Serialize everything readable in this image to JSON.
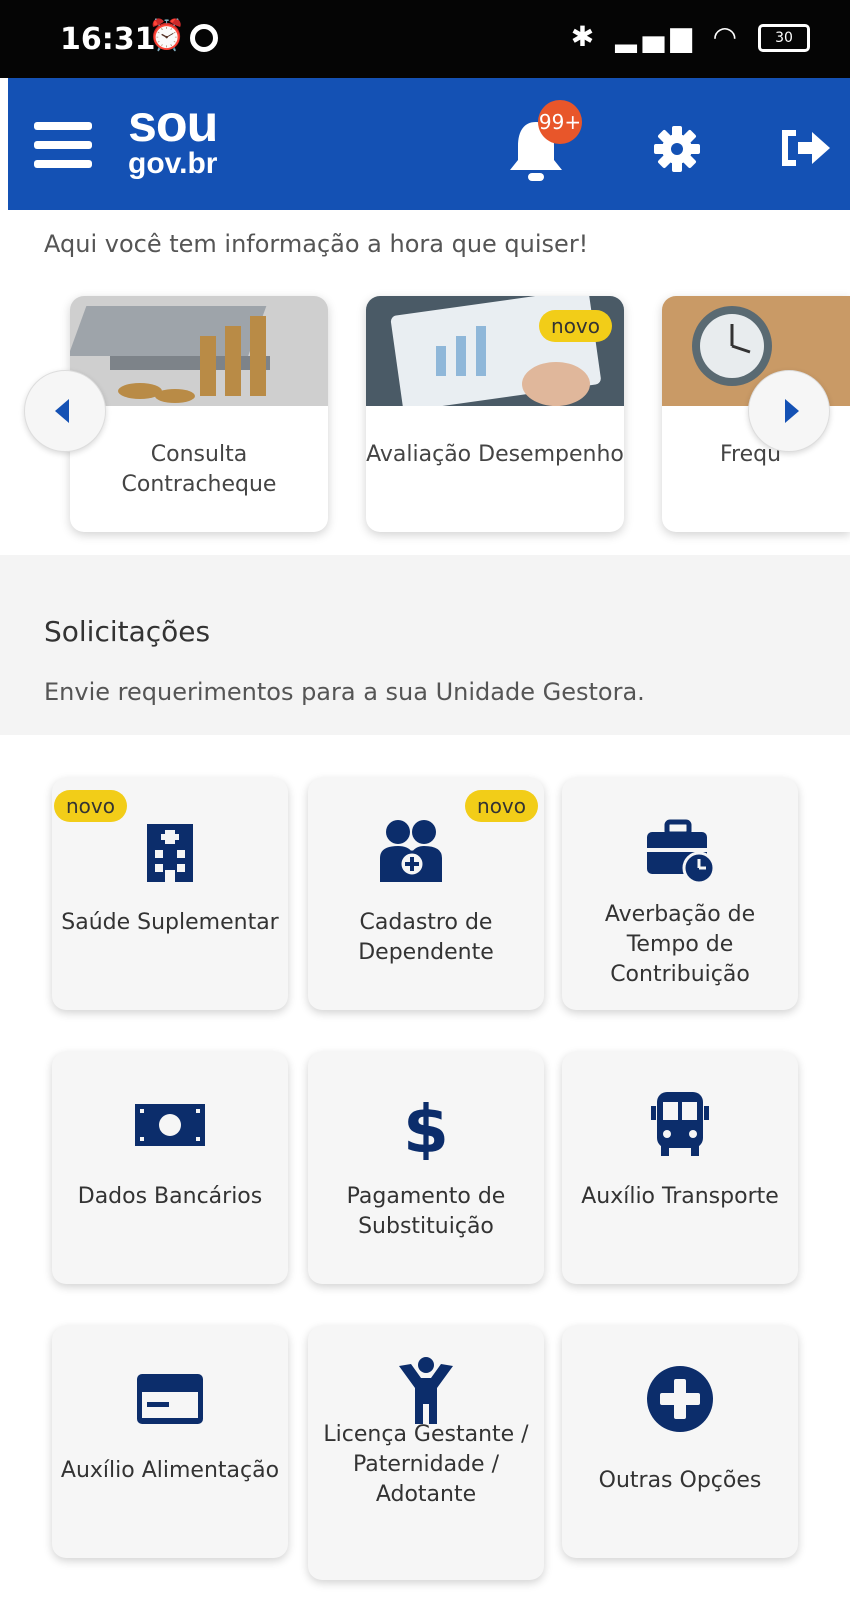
{
  "status_bar": {
    "time": "16:31",
    "battery": "30"
  },
  "header": {
    "logo_top": "sou",
    "logo_bottom": "gov.br",
    "notification_badge": "99+"
  },
  "tagline": "Aqui você tem informação a hora que quiser!",
  "carousel": {
    "cards": [
      {
        "label": "Consulta Contracheque"
      },
      {
        "label": "Avaliação Desempenho",
        "tag": "novo"
      },
      {
        "label": "Frequ"
      }
    ]
  },
  "section": {
    "title": "Solicitações",
    "subtitle": "Envie requerimentos para a sua Unidade Gestora."
  },
  "tiles": [
    {
      "label": "Saúde Suplementar",
      "tag": "novo",
      "icon": "hospital-icon"
    },
    {
      "label": "Cadastro de Dependente",
      "tag": "novo",
      "icon": "dependents-icon"
    },
    {
      "label": "Averbação de Tempo de Contribuição",
      "icon": "briefcase-clock-icon"
    },
    {
      "label": "Dados Bancários",
      "icon": "banknote-icon"
    },
    {
      "label": "Pagamento de Substituição",
      "icon": "dollar-icon"
    },
    {
      "label": "Auxílio Transporte",
      "icon": "bus-icon"
    },
    {
      "label": "Auxílio Alimentação",
      "icon": "credit-card-icon"
    },
    {
      "label": "Licença Gestante / Paternidade / Adotante",
      "icon": "child-icon"
    },
    {
      "label": "Outras Opções",
      "icon": "plus-circle-icon"
    }
  ],
  "colors": {
    "brand_blue": "#1451b4",
    "icon_navy": "#0c2d6b",
    "tag_yellow": "#f2cd18"
  }
}
